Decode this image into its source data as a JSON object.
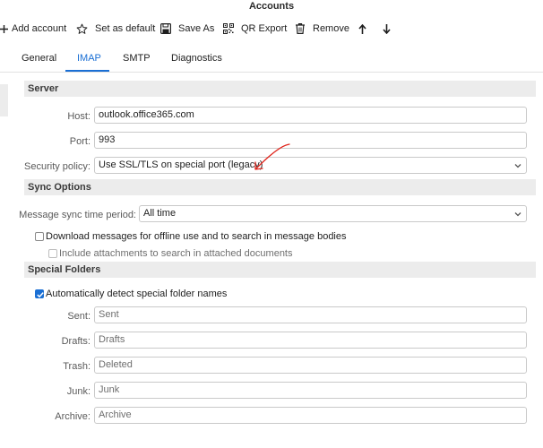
{
  "window": {
    "title": "Accounts"
  },
  "toolbar": {
    "add_account": "Add account",
    "set_default": "Set as default",
    "save_as": "Save As",
    "qr_export": "QR Export",
    "remove": "Remove"
  },
  "tabs": {
    "general": "General",
    "imap": "IMAP",
    "smtp": "SMTP",
    "diagnostics": "Diagnostics",
    "active": "IMAP"
  },
  "server": {
    "header": "Server",
    "host_label": "Host:",
    "host_value": "outlook.office365.com",
    "port_label": "Port:",
    "port_value": "993",
    "security_label": "Security policy:",
    "security_value": "Use SSL/TLS on special port (legacy)"
  },
  "sync": {
    "header": "Sync Options",
    "period_label": "Message sync time period:",
    "period_value": "All time",
    "download_label": "Download messages for offline use and to search in message bodies",
    "download_checked": false,
    "attachments_label": "Include attachments to search in attached documents",
    "attachments_checked": false
  },
  "folders": {
    "header": "Special Folders",
    "auto_detect_label": "Automatically detect special folder names",
    "auto_detect_checked": true,
    "sent_label": "Sent:",
    "sent_value": "Sent",
    "drafts_label": "Drafts:",
    "drafts_value": "Drafts",
    "trash_label": "Trash:",
    "trash_value": "Deleted",
    "junk_label": "Junk:",
    "junk_value": "Junk",
    "archive_label": "Archive:",
    "archive_value": "Archive"
  },
  "colors": {
    "accent": "#1a6fd4",
    "annotation": "#e0241b",
    "section_bg": "#ececec"
  },
  "icons": {
    "add": "plus-icon",
    "default": "star-icon",
    "save": "floppy-disk-icon",
    "qr": "qr-code-icon",
    "remove": "trash-icon",
    "up": "arrow-up-icon",
    "down": "arrow-down-icon"
  }
}
